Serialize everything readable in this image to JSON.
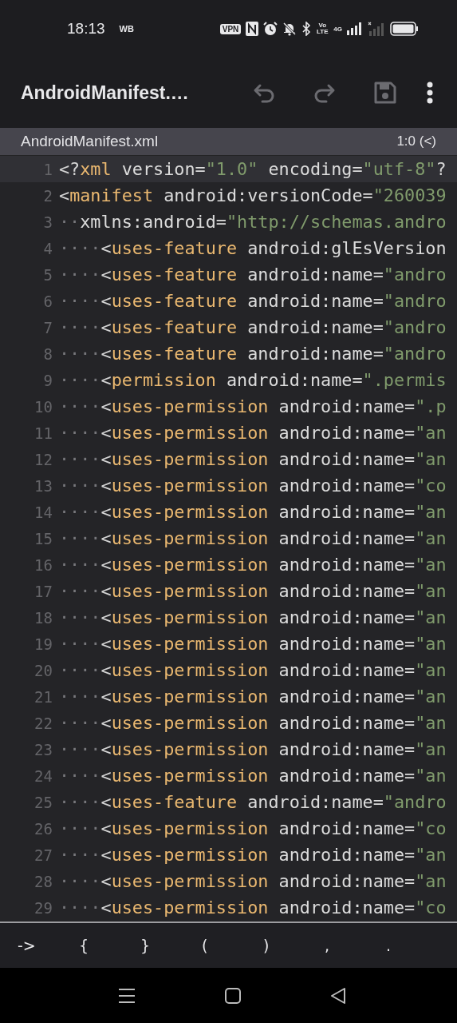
{
  "status_bar": {
    "time": "18:13",
    "carrier": "WB",
    "vpn": "VPN",
    "volte": "Vo LTE",
    "network": "4G"
  },
  "app_bar": {
    "title": "AndroidManifest.…",
    "actions": [
      {
        "kind": "undo",
        "disabled": true
      },
      {
        "kind": "redo",
        "disabled": true
      },
      {
        "kind": "save",
        "disabled": true
      },
      {
        "kind": "more",
        "disabled": false
      }
    ]
  },
  "file_tab": {
    "name": "AndroidManifest.xml",
    "position": "1:0 (<)"
  },
  "editor": {
    "lines": [
      {
        "number": "1",
        "current": true,
        "tokens": [
          {
            "kind": "punct",
            "text": "<?"
          },
          {
            "kind": "tag",
            "text": "xml"
          },
          {
            "kind": "attr",
            "text": " version="
          },
          {
            "kind": "str",
            "text": "\"1.0\""
          },
          {
            "kind": "attr",
            "text": " encoding="
          },
          {
            "kind": "str",
            "text": "\"utf-8\""
          },
          {
            "kind": "punct",
            "text": "?"
          }
        ]
      },
      {
        "number": "2",
        "current": false,
        "tokens": [
          {
            "kind": "punct",
            "text": "<"
          },
          {
            "kind": "tag",
            "text": "manifest"
          },
          {
            "kind": "attr",
            "text": " android:versionCode="
          },
          {
            "kind": "str",
            "text": "\"260039"
          }
        ]
      },
      {
        "number": "3",
        "current": false,
        "tokens": [
          {
            "kind": "space",
            "text": "··"
          },
          {
            "kind": "attr",
            "text": "xmlns:android="
          },
          {
            "kind": "str",
            "text": "\"http://schemas.andro"
          }
        ]
      },
      {
        "number": "4",
        "current": false,
        "tokens": [
          {
            "kind": "space",
            "text": "····"
          },
          {
            "kind": "punct",
            "text": "<"
          },
          {
            "kind": "tag",
            "text": "uses-feature"
          },
          {
            "kind": "attr",
            "text": " android:glEsVersion"
          }
        ]
      },
      {
        "number": "5",
        "current": false,
        "tokens": [
          {
            "kind": "space",
            "text": "····"
          },
          {
            "kind": "punct",
            "text": "<"
          },
          {
            "kind": "tag",
            "text": "uses-feature"
          },
          {
            "kind": "attr",
            "text": " android:name="
          },
          {
            "kind": "str",
            "text": "\"andro"
          }
        ]
      },
      {
        "number": "6",
        "current": false,
        "tokens": [
          {
            "kind": "space",
            "text": "····"
          },
          {
            "kind": "punct",
            "text": "<"
          },
          {
            "kind": "tag",
            "text": "uses-feature"
          },
          {
            "kind": "attr",
            "text": " android:name="
          },
          {
            "kind": "str",
            "text": "\"andro"
          }
        ]
      },
      {
        "number": "7",
        "current": false,
        "tokens": [
          {
            "kind": "space",
            "text": "····"
          },
          {
            "kind": "punct",
            "text": "<"
          },
          {
            "kind": "tag",
            "text": "uses-feature"
          },
          {
            "kind": "attr",
            "text": " android:name="
          },
          {
            "kind": "str",
            "text": "\"andro"
          }
        ]
      },
      {
        "number": "8",
        "current": false,
        "tokens": [
          {
            "kind": "space",
            "text": "····"
          },
          {
            "kind": "punct",
            "text": "<"
          },
          {
            "kind": "tag",
            "text": "uses-feature"
          },
          {
            "kind": "attr",
            "text": " android:name="
          },
          {
            "kind": "str",
            "text": "\"andro"
          }
        ]
      },
      {
        "number": "9",
        "current": false,
        "tokens": [
          {
            "kind": "space",
            "text": "····"
          },
          {
            "kind": "punct",
            "text": "<"
          },
          {
            "kind": "tag",
            "text": "permission"
          },
          {
            "kind": "attr",
            "text": " android:name="
          },
          {
            "kind": "str",
            "text": "\".permis"
          }
        ]
      },
      {
        "number": "10",
        "current": false,
        "tokens": [
          {
            "kind": "space",
            "text": "····"
          },
          {
            "kind": "punct",
            "text": "<"
          },
          {
            "kind": "tag",
            "text": "uses-permission"
          },
          {
            "kind": "attr",
            "text": " android:name="
          },
          {
            "kind": "str",
            "text": "\".p"
          }
        ]
      },
      {
        "number": "11",
        "current": false,
        "tokens": [
          {
            "kind": "space",
            "text": "····"
          },
          {
            "kind": "punct",
            "text": "<"
          },
          {
            "kind": "tag",
            "text": "uses-permission"
          },
          {
            "kind": "attr",
            "text": " android:name="
          },
          {
            "kind": "str",
            "text": "\"an"
          }
        ]
      },
      {
        "number": "12",
        "current": false,
        "tokens": [
          {
            "kind": "space",
            "text": "····"
          },
          {
            "kind": "punct",
            "text": "<"
          },
          {
            "kind": "tag",
            "text": "uses-permission"
          },
          {
            "kind": "attr",
            "text": " android:name="
          },
          {
            "kind": "str",
            "text": "\"an"
          }
        ]
      },
      {
        "number": "13",
        "current": false,
        "tokens": [
          {
            "kind": "space",
            "text": "····"
          },
          {
            "kind": "punct",
            "text": "<"
          },
          {
            "kind": "tag",
            "text": "uses-permission"
          },
          {
            "kind": "attr",
            "text": " android:name="
          },
          {
            "kind": "str",
            "text": "\"co"
          }
        ]
      },
      {
        "number": "14",
        "current": false,
        "tokens": [
          {
            "kind": "space",
            "text": "····"
          },
          {
            "kind": "punct",
            "text": "<"
          },
          {
            "kind": "tag",
            "text": "uses-permission"
          },
          {
            "kind": "attr",
            "text": " android:name="
          },
          {
            "kind": "str",
            "text": "\"an"
          }
        ]
      },
      {
        "number": "15",
        "current": false,
        "tokens": [
          {
            "kind": "space",
            "text": "····"
          },
          {
            "kind": "punct",
            "text": "<"
          },
          {
            "kind": "tag",
            "text": "uses-permission"
          },
          {
            "kind": "attr",
            "text": " android:name="
          },
          {
            "kind": "str",
            "text": "\"an"
          }
        ]
      },
      {
        "number": "16",
        "current": false,
        "tokens": [
          {
            "kind": "space",
            "text": "····"
          },
          {
            "kind": "punct",
            "text": "<"
          },
          {
            "kind": "tag",
            "text": "uses-permission"
          },
          {
            "kind": "attr",
            "text": " android:name="
          },
          {
            "kind": "str",
            "text": "\"an"
          }
        ]
      },
      {
        "number": "17",
        "current": false,
        "tokens": [
          {
            "kind": "space",
            "text": "····"
          },
          {
            "kind": "punct",
            "text": "<"
          },
          {
            "kind": "tag",
            "text": "uses-permission"
          },
          {
            "kind": "attr",
            "text": " android:name="
          },
          {
            "kind": "str",
            "text": "\"an"
          }
        ]
      },
      {
        "number": "18",
        "current": false,
        "tokens": [
          {
            "kind": "space",
            "text": "····"
          },
          {
            "kind": "punct",
            "text": "<"
          },
          {
            "kind": "tag",
            "text": "uses-permission"
          },
          {
            "kind": "attr",
            "text": " android:name="
          },
          {
            "kind": "str",
            "text": "\"an"
          }
        ]
      },
      {
        "number": "19",
        "current": false,
        "tokens": [
          {
            "kind": "space",
            "text": "····"
          },
          {
            "kind": "punct",
            "text": "<"
          },
          {
            "kind": "tag",
            "text": "uses-permission"
          },
          {
            "kind": "attr",
            "text": " android:name="
          },
          {
            "kind": "str",
            "text": "\"an"
          }
        ]
      },
      {
        "number": "20",
        "current": false,
        "tokens": [
          {
            "kind": "space",
            "text": "····"
          },
          {
            "kind": "punct",
            "text": "<"
          },
          {
            "kind": "tag",
            "text": "uses-permission"
          },
          {
            "kind": "attr",
            "text": " android:name="
          },
          {
            "kind": "str",
            "text": "\"an"
          }
        ]
      },
      {
        "number": "21",
        "current": false,
        "tokens": [
          {
            "kind": "space",
            "text": "····"
          },
          {
            "kind": "punct",
            "text": "<"
          },
          {
            "kind": "tag",
            "text": "uses-permission"
          },
          {
            "kind": "attr",
            "text": " android:name="
          },
          {
            "kind": "str",
            "text": "\"an"
          }
        ]
      },
      {
        "number": "22",
        "current": false,
        "tokens": [
          {
            "kind": "space",
            "text": "····"
          },
          {
            "kind": "punct",
            "text": "<"
          },
          {
            "kind": "tag",
            "text": "uses-permission"
          },
          {
            "kind": "attr",
            "text": " android:name="
          },
          {
            "kind": "str",
            "text": "\"an"
          }
        ]
      },
      {
        "number": "23",
        "current": false,
        "tokens": [
          {
            "kind": "space",
            "text": "····"
          },
          {
            "kind": "punct",
            "text": "<"
          },
          {
            "kind": "tag",
            "text": "uses-permission"
          },
          {
            "kind": "attr",
            "text": " android:name="
          },
          {
            "kind": "str",
            "text": "\"an"
          }
        ]
      },
      {
        "number": "24",
        "current": false,
        "tokens": [
          {
            "kind": "space",
            "text": "····"
          },
          {
            "kind": "punct",
            "text": "<"
          },
          {
            "kind": "tag",
            "text": "uses-permission"
          },
          {
            "kind": "attr",
            "text": " android:name="
          },
          {
            "kind": "str",
            "text": "\"an"
          }
        ]
      },
      {
        "number": "25",
        "current": false,
        "tokens": [
          {
            "kind": "space",
            "text": "····"
          },
          {
            "kind": "punct",
            "text": "<"
          },
          {
            "kind": "tag",
            "text": "uses-feature"
          },
          {
            "kind": "attr",
            "text": " android:name="
          },
          {
            "kind": "str",
            "text": "\"andro"
          }
        ]
      },
      {
        "number": "26",
        "current": false,
        "tokens": [
          {
            "kind": "space",
            "text": "····"
          },
          {
            "kind": "punct",
            "text": "<"
          },
          {
            "kind": "tag",
            "text": "uses-permission"
          },
          {
            "kind": "attr",
            "text": " android:name="
          },
          {
            "kind": "str",
            "text": "\"co"
          }
        ]
      },
      {
        "number": "27",
        "current": false,
        "tokens": [
          {
            "kind": "space",
            "text": "····"
          },
          {
            "kind": "punct",
            "text": "<"
          },
          {
            "kind": "tag",
            "text": "uses-permission"
          },
          {
            "kind": "attr",
            "text": " android:name="
          },
          {
            "kind": "str",
            "text": "\"an"
          }
        ]
      },
      {
        "number": "28",
        "current": false,
        "tokens": [
          {
            "kind": "space",
            "text": "····"
          },
          {
            "kind": "punct",
            "text": "<"
          },
          {
            "kind": "tag",
            "text": "uses-permission"
          },
          {
            "kind": "attr",
            "text": " android:name="
          },
          {
            "kind": "str",
            "text": "\"an"
          }
        ]
      },
      {
        "number": "29",
        "current": false,
        "tokens": [
          {
            "kind": "space",
            "text": "····"
          },
          {
            "kind": "punct",
            "text": "<"
          },
          {
            "kind": "tag",
            "text": "uses-permission"
          },
          {
            "kind": "attr",
            "text": " android:name="
          },
          {
            "kind": "str",
            "text": "\"co"
          }
        ]
      }
    ]
  },
  "symbol_bar": {
    "keys": [
      "->",
      "{",
      "}",
      "(",
      ")",
      ",",
      "."
    ]
  },
  "nav_bar": {
    "buttons": [
      {
        "kind": "menu"
      },
      {
        "kind": "home"
      },
      {
        "kind": "back"
      }
    ]
  }
}
